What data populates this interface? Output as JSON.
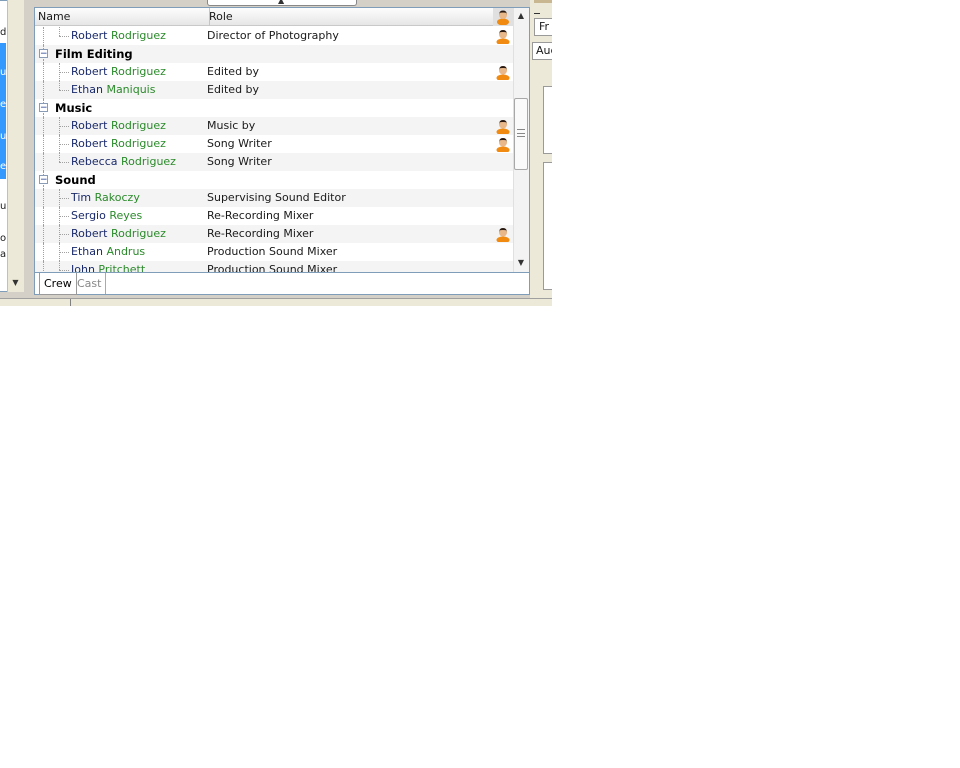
{
  "header": {
    "name_label": "Name",
    "role_label": "Role",
    "photo_icon": "person-icon"
  },
  "tabs": {
    "crew": "Crew",
    "cast": "Cast"
  },
  "right_panel": {
    "tab1_fragment": "Fr",
    "tab2_fragment": "Auc"
  },
  "left_panel": {
    "fragments": [
      "d",
      "u",
      "e",
      "u",
      "e",
      "u",
      "or",
      "ar"
    ]
  },
  "rows": [
    {
      "type": "person",
      "first": "Robert",
      "last": "Rodriguez",
      "role": "Director of Photography",
      "photo": true
    },
    {
      "type": "group",
      "label": "Film Editing"
    },
    {
      "type": "person",
      "first": "Robert",
      "last": "Rodriguez",
      "role": "Edited by",
      "photo": true
    },
    {
      "type": "person",
      "first": "Ethan",
      "last": "Maniquis",
      "role": "Edited by",
      "photo": false
    },
    {
      "type": "group",
      "label": "Music"
    },
    {
      "type": "person",
      "first": "Robert",
      "last": "Rodriguez",
      "role": "Music by",
      "photo": true
    },
    {
      "type": "person",
      "first": "Robert",
      "last": "Rodriguez",
      "role": "Song Writer",
      "photo": true
    },
    {
      "type": "person",
      "first": "Rebecca",
      "last": "Rodriguez",
      "role": "Song Writer",
      "photo": false
    },
    {
      "type": "group",
      "label": "Sound"
    },
    {
      "type": "person",
      "first": "Tim",
      "last": "Rakoczy",
      "role": "Supervising Sound Editor",
      "photo": false
    },
    {
      "type": "person",
      "first": "Sergio",
      "last": "Reyes",
      "role": "Re-Recording Mixer",
      "photo": false
    },
    {
      "type": "person",
      "first": "Robert",
      "last": "Rodriguez",
      "role": "Re-Recording Mixer",
      "photo": true
    },
    {
      "type": "person",
      "first": "Ethan",
      "last": "Andrus",
      "role": "Production Sound Mixer",
      "photo": false
    },
    {
      "type": "person",
      "first": "John",
      "last": "Pritchett",
      "role": "Production Sound Mixer",
      "photo": false
    }
  ],
  "colors": {
    "first_name": "#1a2a6a",
    "last_name": "#2a8a2a",
    "selection": "#3399ff"
  }
}
